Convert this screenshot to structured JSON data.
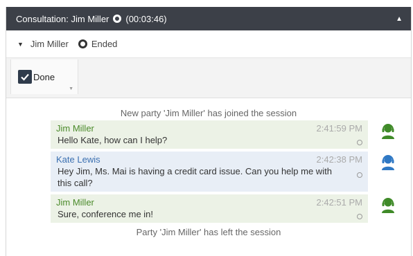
{
  "window": {
    "title": "Consultation: Jim Miller",
    "timer": "(00:03:46)",
    "collapse_icon": "chevron-up-icon"
  },
  "party": {
    "name": "Jim Miller",
    "status": "Ended"
  },
  "toolbar": {
    "done_label": "Done"
  },
  "transcript": {
    "joined_notice": "New party 'Jim Miller' has joined the session",
    "left_notice": "Party 'Jim Miller' has left the session",
    "messages": [
      {
        "sender": "Jim Miller",
        "time": "2:41:59 PM",
        "text": "Hello Kate, how can I help?",
        "color": "#4a8a2a",
        "icon": "agent-headset-icon"
      },
      {
        "sender": "Kate Lewis",
        "time": "2:42:38 PM",
        "text": "Hey Jim, Ms. Mai is having a credit card issue. Can you help me with this call?",
        "color": "#3a6fb0",
        "icon": "agent-headset-icon"
      },
      {
        "sender": "Jim Miller",
        "time": "2:42:51 PM",
        "text": "Sure, conference me in!",
        "color": "#4a8a2a",
        "icon": "agent-headset-icon"
      }
    ]
  },
  "colors": {
    "titlebar_bg": "#3c4048",
    "green_bubble": "#ecf2e6",
    "blue_bubble": "#e8eef6",
    "green_icon": "#3f8a28",
    "blue_icon": "#2f78c4"
  }
}
